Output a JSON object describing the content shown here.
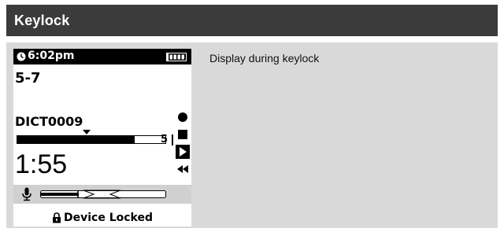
{
  "header": {
    "title": "Keylock"
  },
  "caption": "Display during keylock",
  "device": {
    "status": {
      "time": "6:02pm",
      "battery_icon": "battery-full-icon",
      "clock_icon": "clock-icon"
    },
    "folder": "5-7",
    "file_name": "DICT0009",
    "index_mark": "5",
    "position_fraction": 0.79,
    "elapsed_time": "1:55",
    "state_icons": [
      "record-icon",
      "stop-icon",
      "play-icon",
      "rewind-icon"
    ],
    "lock_message": "Device Locked",
    "lock_icon": "lock-icon",
    "mic_icon": "microphone-icon"
  },
  "colors": {
    "header_bg": "#3b3b3b",
    "panel_bg": "#d9d9d9",
    "display_bg": "#ffffff",
    "ink": "#000000"
  }
}
